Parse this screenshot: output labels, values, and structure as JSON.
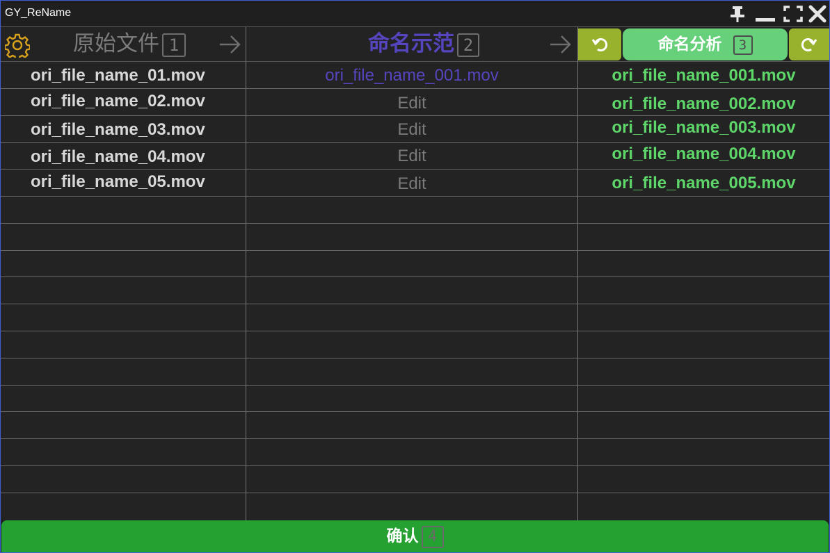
{
  "window": {
    "title": "GY_ReName"
  },
  "header": {
    "col1": {
      "label": "原始文件",
      "step": "1"
    },
    "col2": {
      "label": "命名示范",
      "step": "2"
    },
    "col3": {
      "label": "命名分析",
      "step": "3"
    }
  },
  "colors": {
    "accent_blue": "#5545bf",
    "accent_green": "#5ed66a",
    "button_olive": "#99b22d",
    "button_green": "#66d17a",
    "confirm_green": "#25a132",
    "window_border": "#3c5fd8"
  },
  "rows": [
    {
      "original": "ori_file_name_01.mov",
      "example": "ori_file_name_001.mov",
      "result": "ori_file_name_001.mov"
    },
    {
      "original": "ori_file_name_02.mov",
      "example": "Edit",
      "result": "ori_file_name_002.mov"
    },
    {
      "original": "ori_file_name_03.mov",
      "example": "Edit",
      "result": "ori_file_name_003.mov"
    },
    {
      "original": "ori_file_name_04.mov",
      "example": "Edit",
      "result": "ori_file_name_004.mov"
    },
    {
      "original": "ori_file_name_05.mov",
      "example": "Edit",
      "result": "ori_file_name_005.mov"
    }
  ],
  "footer": {
    "confirm_label": "确认",
    "step": "4"
  },
  "icons": [
    "gear-icon",
    "arrow-right-icon",
    "undo-icon",
    "redo-icon",
    "pin-icon",
    "minimize-icon",
    "fullscreen-icon",
    "close-icon"
  ]
}
